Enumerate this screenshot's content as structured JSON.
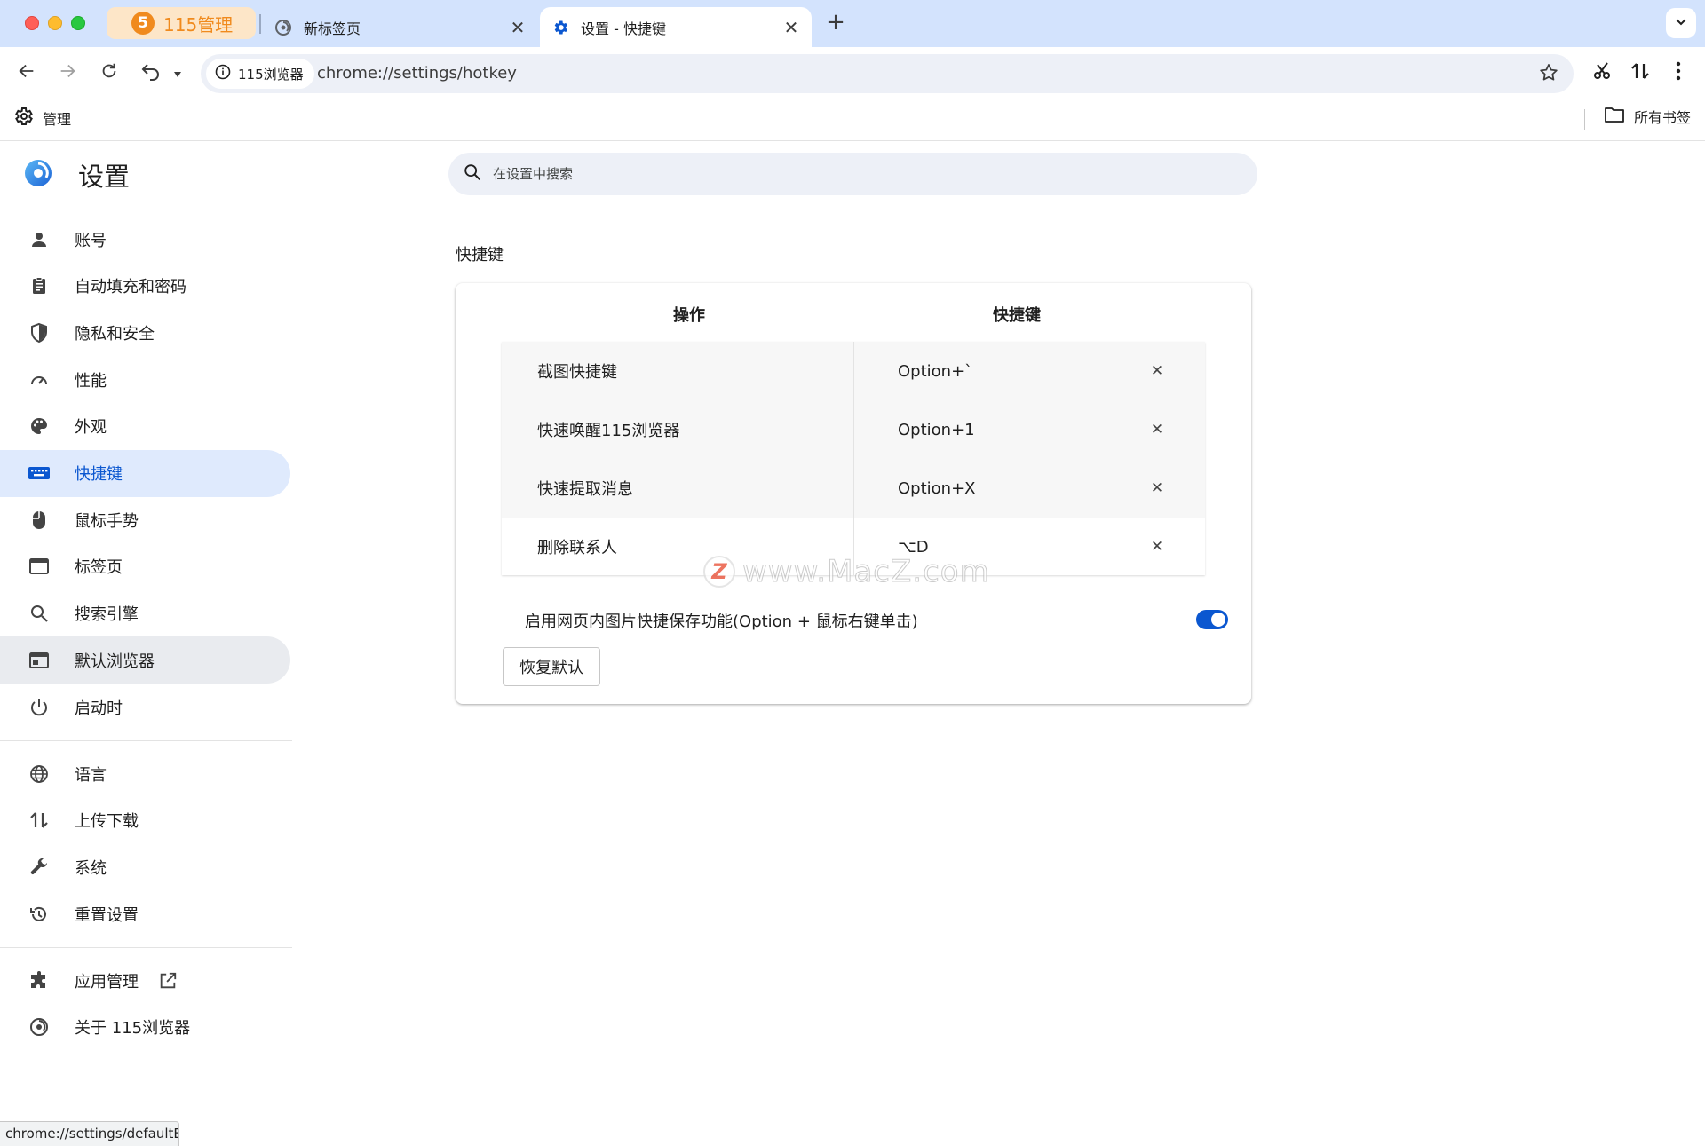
{
  "tabs": {
    "pinned": {
      "logo": "5",
      "title": "115管理"
    },
    "newtab": {
      "title": "新标签页",
      "icon": "browser-logo-icon"
    },
    "active": {
      "title": "设置 - 快捷键",
      "icon": "gear-icon"
    },
    "close_glyph": "✕",
    "new_tab_glyph": "+"
  },
  "toolbar": {
    "site_chip": "115浏览器",
    "url": "chrome://settings/hotkey"
  },
  "bookmarks": {
    "manage": "管理",
    "all": "所有书签"
  },
  "sidebar": {
    "title": "设置",
    "items": [
      {
        "label": "账号",
        "icon": "person-icon"
      },
      {
        "label": "自动填充和密码",
        "icon": "clipboard-icon"
      },
      {
        "label": "隐私和安全",
        "icon": "shield-icon"
      },
      {
        "label": "性能",
        "icon": "speedometer-icon"
      },
      {
        "label": "外观",
        "icon": "palette-icon"
      },
      {
        "label": "快捷键",
        "icon": "keyboard-icon"
      },
      {
        "label": "鼠标手势",
        "icon": "mouse-icon"
      },
      {
        "label": "标签页",
        "icon": "tab-window-icon"
      },
      {
        "label": "搜索引擎",
        "icon": "search-icon"
      },
      {
        "label": "默认浏览器",
        "icon": "browser-window-icon"
      },
      {
        "label": "启动时",
        "icon": "power-icon"
      }
    ],
    "items2": [
      {
        "label": "语言",
        "icon": "globe-icon"
      },
      {
        "label": "上传下载",
        "icon": "transfer-icon"
      },
      {
        "label": "系统",
        "icon": "wrench-icon"
      },
      {
        "label": "重置设置",
        "icon": "history-icon"
      }
    ],
    "items3": [
      {
        "label": "应用管理",
        "icon": "puzzle-icon"
      },
      {
        "label": "关于 115浏览器",
        "icon": "browser-logo-icon"
      }
    ]
  },
  "search": {
    "placeholder": "在设置中搜索"
  },
  "section": {
    "title": "快捷键"
  },
  "table": {
    "headers": [
      "操作",
      "快捷键"
    ],
    "rows": [
      {
        "action": "截图快捷键",
        "key": "Option+`"
      },
      {
        "action": "快速唤醒115浏览器",
        "key": "Option+1"
      },
      {
        "action": "快速提取消息",
        "key": "Option+X"
      },
      {
        "action": "删除联系人",
        "key": "⌥D"
      }
    ],
    "delete_glyph": "✕"
  },
  "image_save": {
    "label": "启用网页内图片快捷保存功能(Option + 鼠标右键单击)",
    "enabled": true
  },
  "reset_button": "恢复默认",
  "watermark": {
    "mark": "Z",
    "text": "www.MacZ.com"
  },
  "status_bar": "chrome://settings/defaultB",
  "colors": {
    "accent": "#0b57d0",
    "tabstrip": "#d3e3fd",
    "active_item_bg": "#dfeafd"
  }
}
